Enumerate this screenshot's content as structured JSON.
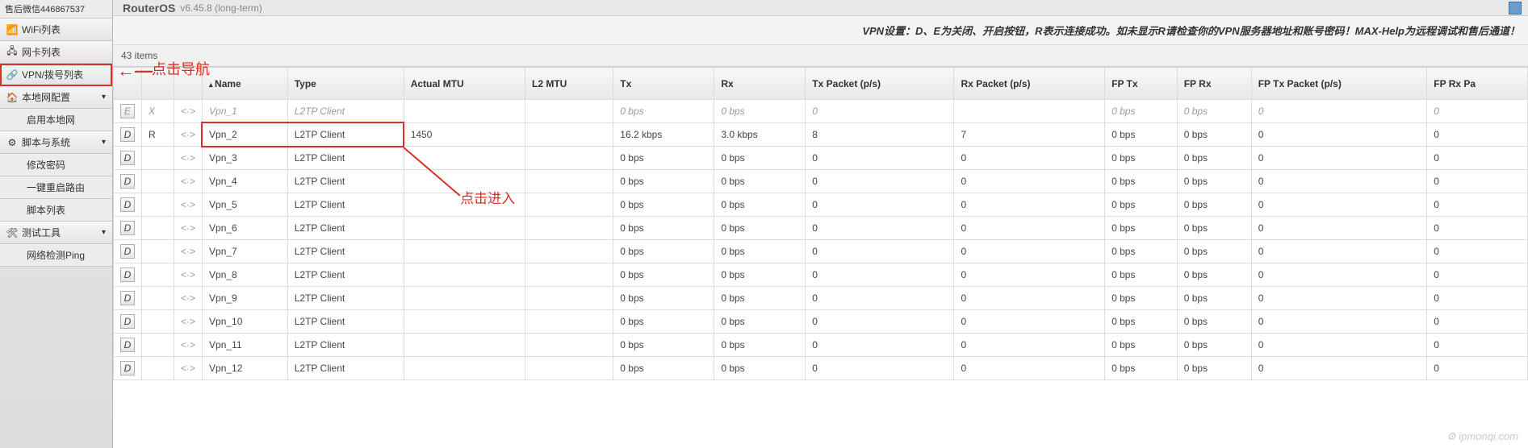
{
  "header": {
    "support": "售后微信446867537",
    "brand": "RouterOS",
    "version": "v6.45.8 (long-term)"
  },
  "sidebar": {
    "items": [
      {
        "icon": "📶",
        "label": "WiFi列表",
        "interact": true
      },
      {
        "icon": "🖧",
        "label": "网卡列表",
        "interact": true
      },
      {
        "icon": "🔗",
        "label": "VPN/拨号列表",
        "interact": true,
        "highlight": true
      },
      {
        "icon": "🏠",
        "label": "本地网配置",
        "chev": "▾",
        "interact": true
      },
      {
        "icon": "",
        "label": "启用本地网",
        "sub": true,
        "interact": true
      },
      {
        "icon": "⚙",
        "label": "脚本与系统",
        "chev": "▾",
        "interact": true
      },
      {
        "icon": "",
        "label": "修改密码",
        "sub": true,
        "interact": true
      },
      {
        "icon": "",
        "label": "一键重启路由",
        "sub": true,
        "interact": true
      },
      {
        "icon": "",
        "label": "脚本列表",
        "sub": true,
        "interact": true
      },
      {
        "icon": "🛠",
        "label": "测试工具",
        "chev": "▾",
        "interact": true
      },
      {
        "icon": "",
        "label": "网络检测Ping",
        "sub": true,
        "interact": true
      }
    ]
  },
  "notice": "VPN设置：D、E为关闭、开启按钮，R表示连接成功。如未显示R请检查你的VPN服务器地址和账号密码！MAX-Help为远程调试和售后通道！",
  "count_label": "43 items",
  "columns": [
    "",
    "",
    "",
    "Name",
    "Type",
    "Actual MTU",
    "L2 MTU",
    "Tx",
    "Rx",
    "Tx Packet (p/s)",
    "Rx Packet (p/s)",
    "FP Tx",
    "FP Rx",
    "FP Tx Packet (p/s)",
    "FP Rx Pa"
  ],
  "rows": [
    {
      "flag": "E",
      "status": "X",
      "name": "Vpn_1",
      "type": "L2TP Client",
      "mtu": "",
      "l2": "",
      "tx": "0 bps",
      "rx": "0 bps",
      "txp": "0",
      "rxp": "",
      "fptx": "0 bps",
      "fprx": "0 bps",
      "ftxp": "0",
      "frxp": "0",
      "disabled": true
    },
    {
      "flag": "D",
      "status": "R",
      "name": "Vpn_2",
      "type": "L2TP Client",
      "mtu": "1450",
      "l2": "",
      "tx": "16.2 kbps",
      "rx": "3.0 kbps",
      "txp": "8",
      "rxp": "7",
      "fptx": "0 bps",
      "fprx": "0 bps",
      "ftxp": "0",
      "frxp": "0",
      "highlight": true
    },
    {
      "flag": "D",
      "status": "",
      "name": "Vpn_3",
      "type": "L2TP Client",
      "mtu": "",
      "l2": "",
      "tx": "0 bps",
      "rx": "0 bps",
      "txp": "0",
      "rxp": "0",
      "fptx": "0 bps",
      "fprx": "0 bps",
      "ftxp": "0",
      "frxp": "0"
    },
    {
      "flag": "D",
      "status": "",
      "name": "Vpn_4",
      "type": "L2TP Client",
      "mtu": "",
      "l2": "",
      "tx": "0 bps",
      "rx": "0 bps",
      "txp": "0",
      "rxp": "0",
      "fptx": "0 bps",
      "fprx": "0 bps",
      "ftxp": "0",
      "frxp": "0"
    },
    {
      "flag": "D",
      "status": "",
      "name": "Vpn_5",
      "type": "L2TP Client",
      "mtu": "",
      "l2": "",
      "tx": "0 bps",
      "rx": "0 bps",
      "txp": "0",
      "rxp": "0",
      "fptx": "0 bps",
      "fprx": "0 bps",
      "ftxp": "0",
      "frxp": "0"
    },
    {
      "flag": "D",
      "status": "",
      "name": "Vpn_6",
      "type": "L2TP Client",
      "mtu": "",
      "l2": "",
      "tx": "0 bps",
      "rx": "0 bps",
      "txp": "0",
      "rxp": "0",
      "fptx": "0 bps",
      "fprx": "0 bps",
      "ftxp": "0",
      "frxp": "0"
    },
    {
      "flag": "D",
      "status": "",
      "name": "Vpn_7",
      "type": "L2TP Client",
      "mtu": "",
      "l2": "",
      "tx": "0 bps",
      "rx": "0 bps",
      "txp": "0",
      "rxp": "0",
      "fptx": "0 bps",
      "fprx": "0 bps",
      "ftxp": "0",
      "frxp": "0"
    },
    {
      "flag": "D",
      "status": "",
      "name": "Vpn_8",
      "type": "L2TP Client",
      "mtu": "",
      "l2": "",
      "tx": "0 bps",
      "rx": "0 bps",
      "txp": "0",
      "rxp": "0",
      "fptx": "0 bps",
      "fprx": "0 bps",
      "ftxp": "0",
      "frxp": "0"
    },
    {
      "flag": "D",
      "status": "",
      "name": "Vpn_9",
      "type": "L2TP Client",
      "mtu": "",
      "l2": "",
      "tx": "0 bps",
      "rx": "0 bps",
      "txp": "0",
      "rxp": "0",
      "fptx": "0 bps",
      "fprx": "0 bps",
      "ftxp": "0",
      "frxp": "0"
    },
    {
      "flag": "D",
      "status": "",
      "name": "Vpn_10",
      "type": "L2TP Client",
      "mtu": "",
      "l2": "",
      "tx": "0 bps",
      "rx": "0 bps",
      "txp": "0",
      "rxp": "0",
      "fptx": "0 bps",
      "fprx": "0 bps",
      "ftxp": "0",
      "frxp": "0"
    },
    {
      "flag": "D",
      "status": "",
      "name": "Vpn_11",
      "type": "L2TP Client",
      "mtu": "",
      "l2": "",
      "tx": "0 bps",
      "rx": "0 bps",
      "txp": "0",
      "rxp": "0",
      "fptx": "0 bps",
      "fprx": "0 bps",
      "ftxp": "0",
      "frxp": "0"
    },
    {
      "flag": "D",
      "status": "",
      "name": "Vpn_12",
      "type": "L2TP Client",
      "mtu": "",
      "l2": "",
      "tx": "0 bps",
      "rx": "0 bps",
      "txp": "0",
      "rxp": "0",
      "fptx": "0 bps",
      "fprx": "0 bps",
      "ftxp": "0",
      "frxp": "0"
    }
  ],
  "annotations": {
    "nav_hint": "点击导航",
    "enter_hint": "点击进入"
  },
  "watermark": "ipmonqi.com"
}
